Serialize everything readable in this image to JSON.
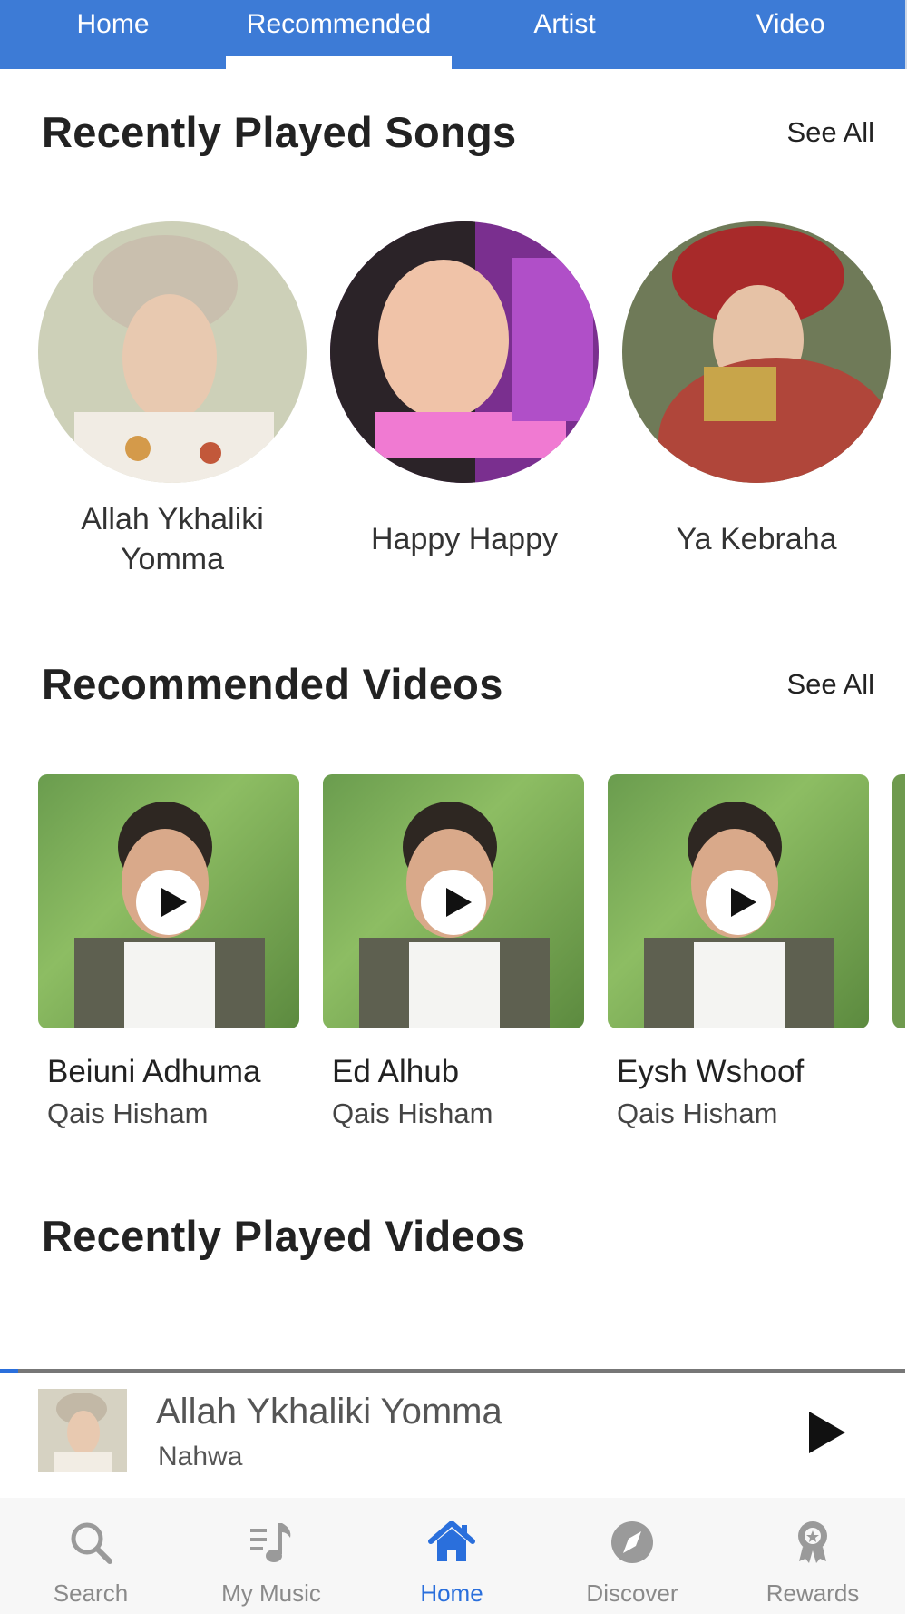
{
  "tabs": [
    {
      "label": "Home"
    },
    {
      "label": "Recommended",
      "active": true
    },
    {
      "label": "Artist"
    },
    {
      "label": "Video"
    }
  ],
  "sections": {
    "recent_songs": {
      "title": "Recently Played Songs",
      "see_all": "See All"
    },
    "recommended_videos": {
      "title": "Recommended Videos",
      "see_all": "See All"
    },
    "recent_videos": {
      "title": "Recently Played Videos"
    }
  },
  "songs": [
    {
      "title": "Allah Ykhaliki Yomma"
    },
    {
      "title": "Happy Happy"
    },
    {
      "title": "Ya Kebraha"
    }
  ],
  "videos": [
    {
      "title": "Beiuni Adhuma",
      "artist": "Qais Hisham"
    },
    {
      "title": "Ed Alhub",
      "artist": "Qais Hisham"
    },
    {
      "title": "Eysh Wshoof",
      "artist": "Qais Hisham"
    }
  ],
  "now_playing": {
    "title": "Allah Ykhaliki Yomma",
    "artist": "Nahwa",
    "progress": 0.02
  },
  "bottom_nav": [
    {
      "label": "Search",
      "icon": "search-icon"
    },
    {
      "label": "My Music",
      "icon": "music-note-icon"
    },
    {
      "label": "Home",
      "icon": "home-icon",
      "active": true
    },
    {
      "label": "Discover",
      "icon": "compass-icon"
    },
    {
      "label": "Rewards",
      "icon": "award-icon"
    }
  ],
  "colors": {
    "accent": "#3d7bd6",
    "active_nav": "#2a6fdc",
    "inactive_nav": "#8a8a8a"
  }
}
